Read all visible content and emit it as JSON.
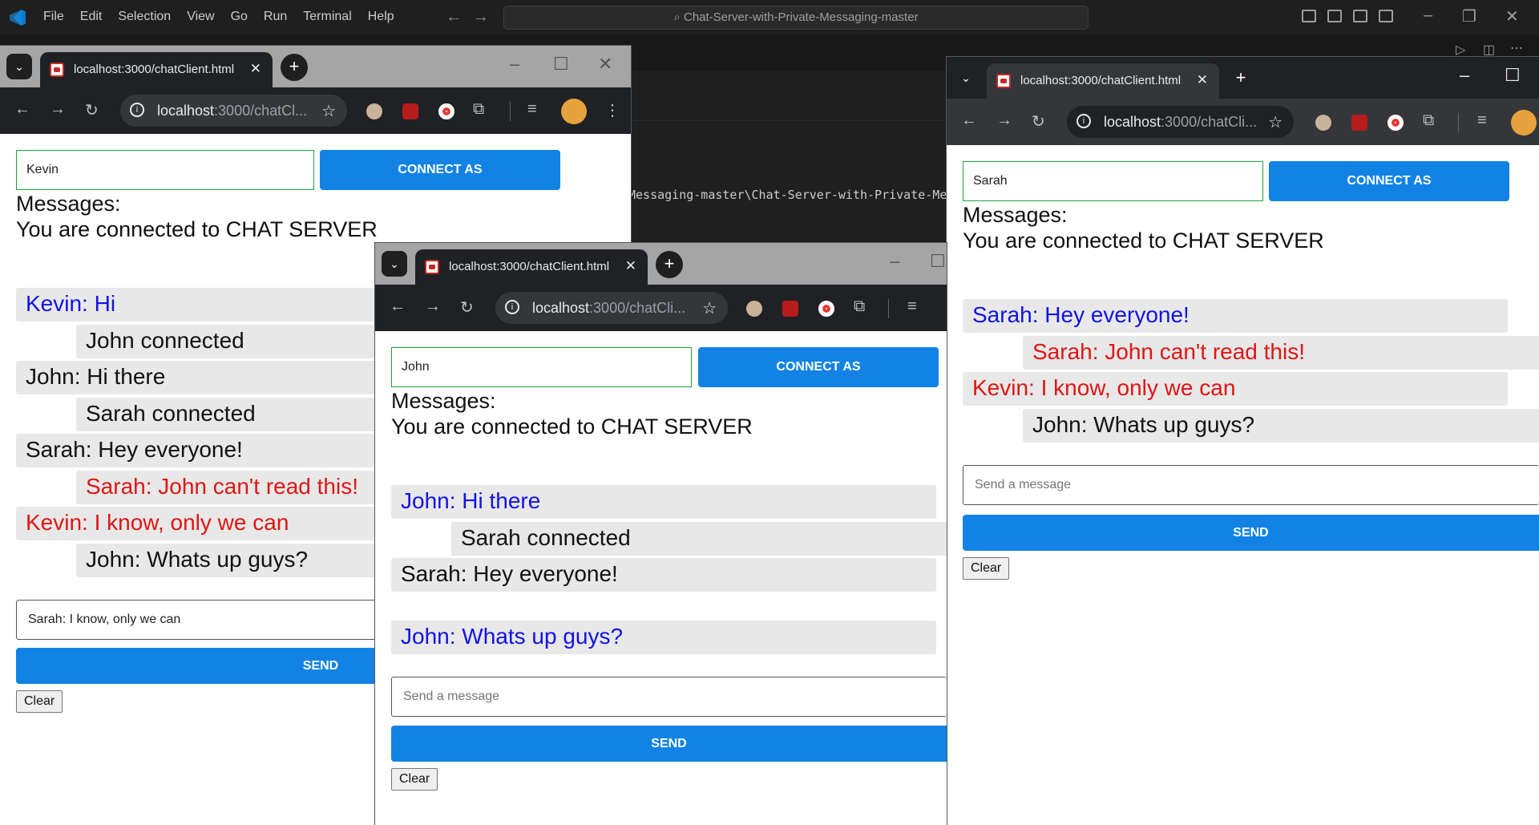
{
  "vscode": {
    "menu": [
      "File",
      "Edit",
      "Selection",
      "View",
      "Go",
      "Run",
      "Terminal",
      "Help"
    ],
    "search": "Chat-Server-with-Private-Messaging-master",
    "terminal_text": "Messaging-master\\Chat-Server-with-Private-Me"
  },
  "windows": {
    "kevin": {
      "tab_title": "localhost:3000/chatClient.html",
      "url_host": "localhost",
      "url_path": ":3000/chatCl...",
      "name": "Kevin",
      "connect_label": "CONNECT AS",
      "messages_label": "Messages:",
      "connected_text": "You are connected to CHAT SERVER",
      "messages": [
        {
          "text": "Kevin: Hi",
          "color": "blue"
        },
        {
          "text": "John connected",
          "color": "black"
        },
        {
          "text": "John: Hi there",
          "color": "black"
        },
        {
          "text": "Sarah connected",
          "color": "black"
        },
        {
          "text": "Sarah: Hey everyone!",
          "color": "black"
        },
        {
          "text": "Sarah: John can't read this!",
          "color": "red"
        },
        {
          "text": "Kevin: I know, only we can",
          "color": "red"
        },
        {
          "text": "John: Whats up guys?",
          "color": "black"
        }
      ],
      "input_value": "Sarah: I know, only we can",
      "send_label": "SEND",
      "clear_label": "Clear"
    },
    "john": {
      "tab_title": "localhost:3000/chatClient.html",
      "url_host": "localhost",
      "url_path": ":3000/chatCli...",
      "name": "John",
      "connect_label": "CONNECT AS",
      "messages_label": "Messages:",
      "connected_text": "You are connected to CHAT SERVER",
      "messages": [
        {
          "text": "John: Hi there",
          "color": "blue"
        },
        {
          "text": "Sarah connected",
          "color": "black"
        },
        {
          "text": "Sarah: Hey everyone!",
          "color": "black"
        },
        {
          "text": "John: Whats up guys?",
          "color": "blue"
        }
      ],
      "input_placeholder": "Send a message",
      "send_label": "SEND",
      "clear_label": "Clear"
    },
    "sarah": {
      "tab_title": "localhost:3000/chatClient.html",
      "url_host": "localhost",
      "url_path": ":3000/chatCli...",
      "name": "Sarah",
      "connect_label": "CONNECT AS",
      "messages_label": "Messages:",
      "connected_text": "You are connected to CHAT SERVER",
      "messages": [
        {
          "text": "Sarah: Hey everyone!",
          "color": "blue"
        },
        {
          "text": "Sarah: John can't read this!",
          "color": "red"
        },
        {
          "text": "Kevin: I know, only we can",
          "color": "red"
        },
        {
          "text": "John: Whats up guys?",
          "color": "black"
        }
      ],
      "input_placeholder": "Send a message",
      "send_label": "SEND",
      "clear_label": "Clear"
    }
  },
  "colors": {
    "accent": "#1283e5",
    "own_message": "#1212e6",
    "private_message": "#e01515",
    "input_border_focus": "#22a33b"
  }
}
